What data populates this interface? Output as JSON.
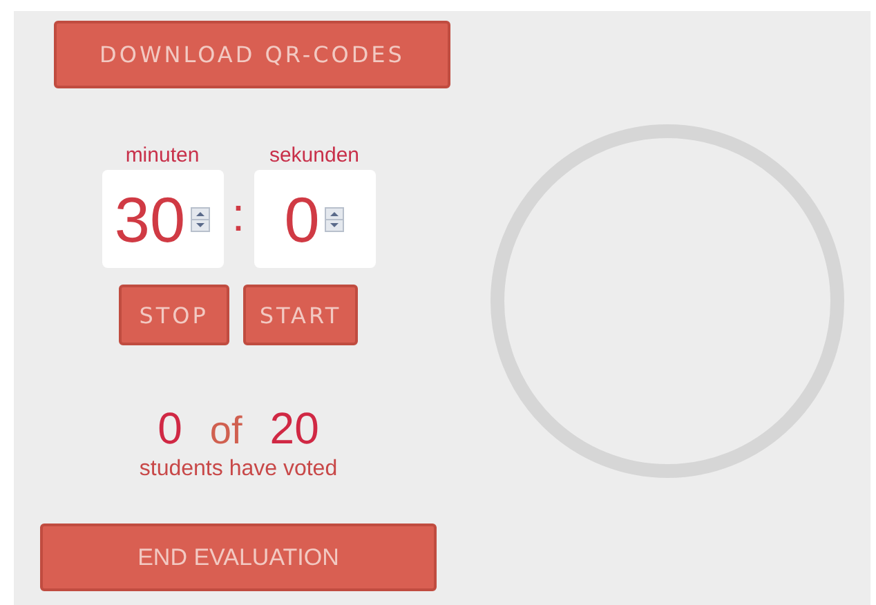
{
  "download_button": "DOWNLOAD QR-CODES",
  "timer": {
    "fields": [
      {
        "label": "minuten",
        "value": "30"
      },
      {
        "label": "sekunden",
        "value": "0"
      }
    ],
    "separator": ":"
  },
  "buttons": [
    "STOP",
    "START"
  ],
  "votes": {
    "count": "0",
    "of": "of",
    "total": "20",
    "caption": "students have voted"
  },
  "end_button": "END EVALUATION"
}
